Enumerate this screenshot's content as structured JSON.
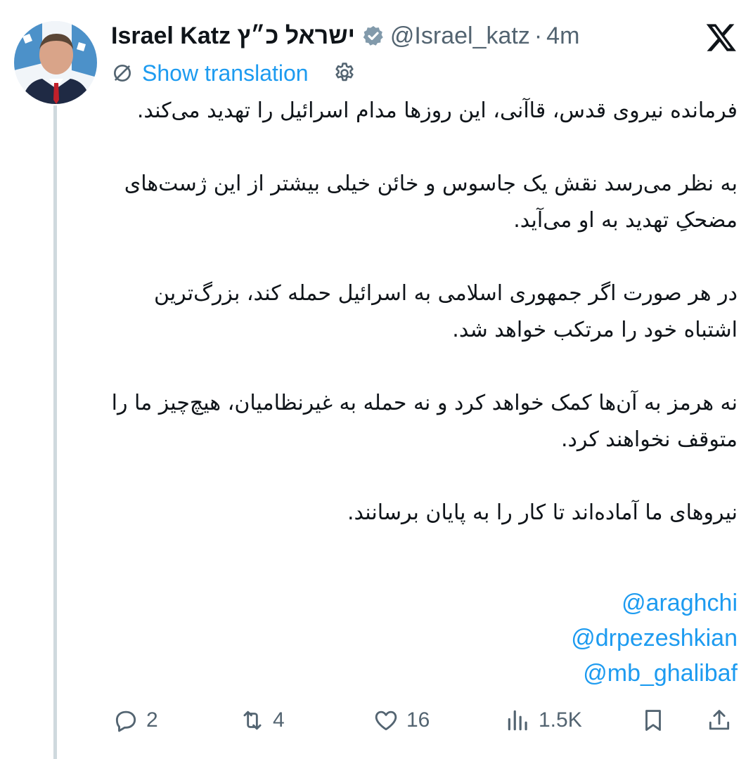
{
  "author": {
    "name": "Israel Katz ישראל כ״ץ",
    "handle": "@Israel_katz",
    "separator": "·",
    "time": "4m",
    "verified_color": "#829aab",
    "avatar_icon": "avatar-photo"
  },
  "translation": {
    "label": "Show translation",
    "icon": "translate-icon",
    "settings_icon": "gear-icon"
  },
  "tweet": {
    "paragraphs": [
      "فرمانده نیروی قدس، قاآنی، این روزها مدام اسرائیل را تهدید می‌کند.",
      "به نظر می‌رسد نقش یک جاسوس و خائن خیلی بیشتر از این ژست‌های مضحکِ تهدید به او می‌آید.",
      "در هر صورت اگر جمهوری اسلامی به اسرائیل حمله کند، بزرگ‌ترین اشتباه خود را مرتکب خواهد شد.",
      "نه هرمز به آن‌ها کمک خواهد کرد و نه حمله به غیرنظامیان، هیچ‌چیز ما را متوقف نخواهند کرد.",
      "نیروهای ما آماده‌اند تا کار را به پایان برسانند."
    ],
    "mentions": [
      "@araghchi",
      "@drpezeshkian",
      "@mb_ghalibaf"
    ]
  },
  "actions": {
    "replies": "2",
    "reposts": "4",
    "likes": "16",
    "views": "1.5K",
    "icons": [
      "reply-icon",
      "repost-icon",
      "like-icon",
      "views-icon",
      "bookmark-icon",
      "share-icon"
    ]
  },
  "colors": {
    "accent": "#1d9bf0",
    "muted": "#536471",
    "text": "#0f1419",
    "thread_line": "#cfd9de"
  }
}
